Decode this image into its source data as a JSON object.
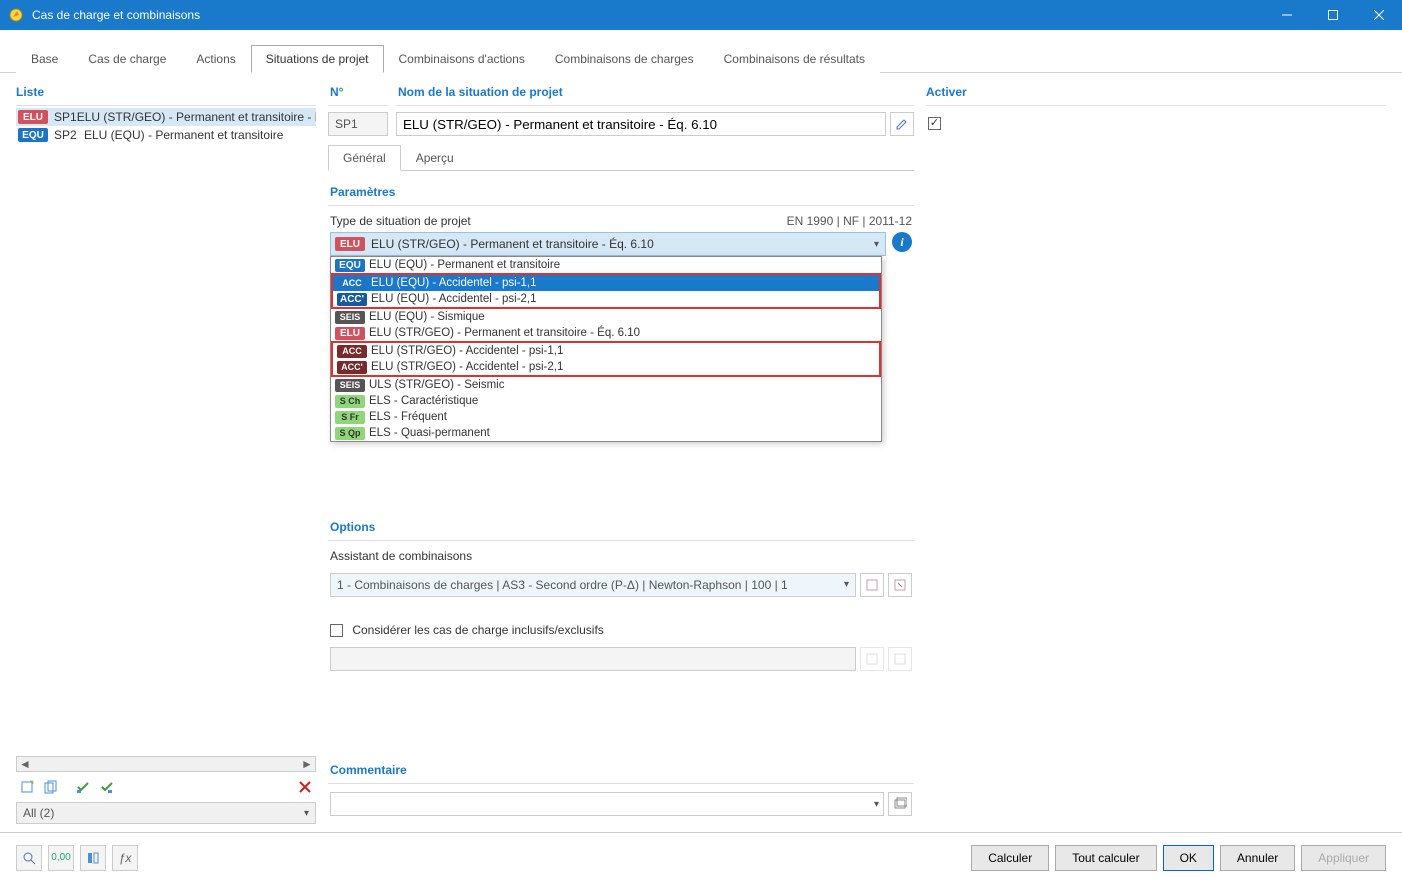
{
  "window": {
    "title": "Cas de charge et combinaisons"
  },
  "tabs": [
    "Base",
    "Cas de charge",
    "Actions",
    "Situations de projet",
    "Combinaisons d'actions",
    "Combinaisons de charges",
    "Combinaisons de résultats"
  ],
  "activeTab": 3,
  "listTitle": "Liste",
  "listItems": [
    {
      "badge": "ELU",
      "badgeCls": "elu",
      "sp": "SP1",
      "text": "ELU (STR/GEO) - Permanent et transitoire - Éq"
    },
    {
      "badge": "EQU",
      "badgeCls": "equ",
      "sp": "SP2",
      "text": "ELU (EQU) - Permanent et transitoire"
    }
  ],
  "filterText": "All (2)",
  "no": {
    "label": "N°",
    "value": "SP1"
  },
  "name": {
    "label": "Nom de la situation de projet",
    "value": "ELU (STR/GEO) - Permanent et transitoire - Éq. 6.10"
  },
  "subtabs": [
    "Général",
    "Aperçu"
  ],
  "paramTitle": "Paramètres",
  "paramTypeLabel": "Type de situation de projet",
  "paramStandard": "EN 1990 | NF | 2011-12",
  "dropdownSelected": {
    "badge": "ELU",
    "badgeCls": "elu",
    "text": "ELU (STR/GEO) - Permanent et transitoire - Éq. 6.10"
  },
  "dropdownItems": [
    {
      "badge": "EQU",
      "badgeCls": "equ",
      "text": "ELU (EQU) - Permanent et transitoire",
      "highlight": false,
      "redbox": "none"
    },
    {
      "badge": "ACC",
      "badgeCls": "acc",
      "text": "ELU (EQU) - Accidentel - psi-1,1",
      "highlight": true,
      "redbox": "top"
    },
    {
      "badge": "ACC'",
      "badgeCls": "acc-equ",
      "text": "ELU (EQU) - Accidentel - psi-2,1",
      "highlight": false,
      "redbox": "bottom"
    },
    {
      "badge": "SEIS",
      "badgeCls": "seis",
      "text": "ELU (EQU) - Sismique",
      "highlight": false,
      "redbox": "none"
    },
    {
      "badge": "ELU",
      "badgeCls": "elu",
      "text": "ELU (STR/GEO) - Permanent et transitoire - Éq. 6.10",
      "highlight": false,
      "redbox": "none"
    },
    {
      "badge": "ACC",
      "badgeCls": "str-acc",
      "text": "ELU (STR/GEO) - Accidentel - psi-1,1",
      "highlight": false,
      "redbox": "top"
    },
    {
      "badge": "ACC'",
      "badgeCls": "str-acc",
      "text": "ELU (STR/GEO) - Accidentel - psi-2,1",
      "highlight": false,
      "redbox": "bottom"
    },
    {
      "badge": "SEIS",
      "badgeCls": "seis",
      "text": "ULS (STR/GEO) - Seismic",
      "highlight": false,
      "redbox": "none"
    },
    {
      "badge": "S Ch",
      "badgeCls": "sch",
      "text": "ELS - Caractéristique",
      "highlight": false,
      "redbox": "none"
    },
    {
      "badge": "S Fr",
      "badgeCls": "sfr",
      "text": "ELS - Fréquent",
      "highlight": false,
      "redbox": "none"
    },
    {
      "badge": "S Qp",
      "badgeCls": "sqp",
      "text": "ELS - Quasi-permanent",
      "highlight": false,
      "redbox": "none"
    }
  ],
  "optionsTitle": "Options",
  "optAssistLabel": "Assistant de combinaisons",
  "optAssistValue": "1 - Combinaisons de charges | AS3 - Second ordre (P-Δ) | Newton-Raphson | 100 | 1",
  "optConsider": "Considérer les cas de charge inclusifs/exclusifs",
  "commentTitle": "Commentaire",
  "activerTitle": "Activer",
  "footer": {
    "calculer": "Calculer",
    "toutCalculer": "Tout calculer",
    "ok": "OK",
    "annuler": "Annuler",
    "appliquer": "Appliquer"
  }
}
